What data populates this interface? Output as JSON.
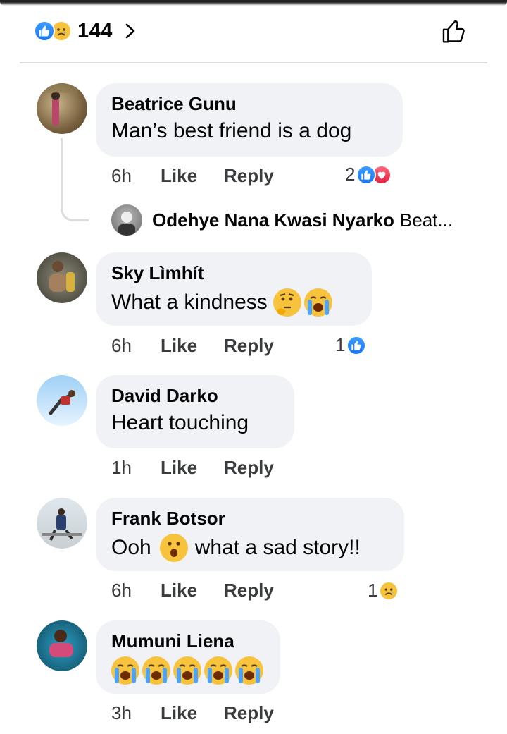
{
  "header": {
    "reaction_count": "144",
    "reaction_icons": [
      "like-icon",
      "sad-icon"
    ],
    "chevron_icon": "chevron-right-icon",
    "like_button_icon": "thumbs-up-outline-icon"
  },
  "comments": [
    {
      "author": "Beatrice Gunu",
      "text": "Man’s best friend is a dog",
      "time": "6h",
      "like_label": "Like",
      "reply_label": "Reply",
      "reaction_count": "2",
      "reactions": [
        "like-icon",
        "love-icon"
      ],
      "reply_preview": {
        "author": "Odehye Nana Kwasi Nyarko",
        "snippet": "Beat..."
      }
    },
    {
      "author": "Sky Lìmhít",
      "text": "What a kindness",
      "emojis": [
        "thinking-face-emoji",
        "loudly-crying-face-emoji"
      ],
      "time": "6h",
      "like_label": "Like",
      "reply_label": "Reply",
      "reaction_count": "1",
      "reactions": [
        "like-icon"
      ]
    },
    {
      "author": "David Darko",
      "text": "Heart touching",
      "time": "1h",
      "like_label": "Like",
      "reply_label": "Reply"
    },
    {
      "author": "Frank Botsor",
      "text_before": "Ooh",
      "text_after": "what a sad story!!",
      "emojis": [
        "astonished-face-emoji"
      ],
      "time": "6h",
      "like_label": "Like",
      "reply_label": "Reply",
      "reaction_count": "1",
      "reactions": [
        "sad-icon"
      ]
    },
    {
      "author": "Mumuni Liena",
      "emojis": [
        "loudly-crying-face-emoji",
        "loudly-crying-face-emoji",
        "loudly-crying-face-emoji",
        "loudly-crying-face-emoji",
        "loudly-crying-face-emoji"
      ],
      "time": "3h",
      "like_label": "Like",
      "reply_label": "Reply"
    }
  ],
  "colors": {
    "like_blue": "#1877f2",
    "love_red": "#e41e3f",
    "emoji_yellow": "#f7c23c",
    "bubble_bg": "#f0f2f5",
    "secondary_text": "#3a3b3c"
  }
}
